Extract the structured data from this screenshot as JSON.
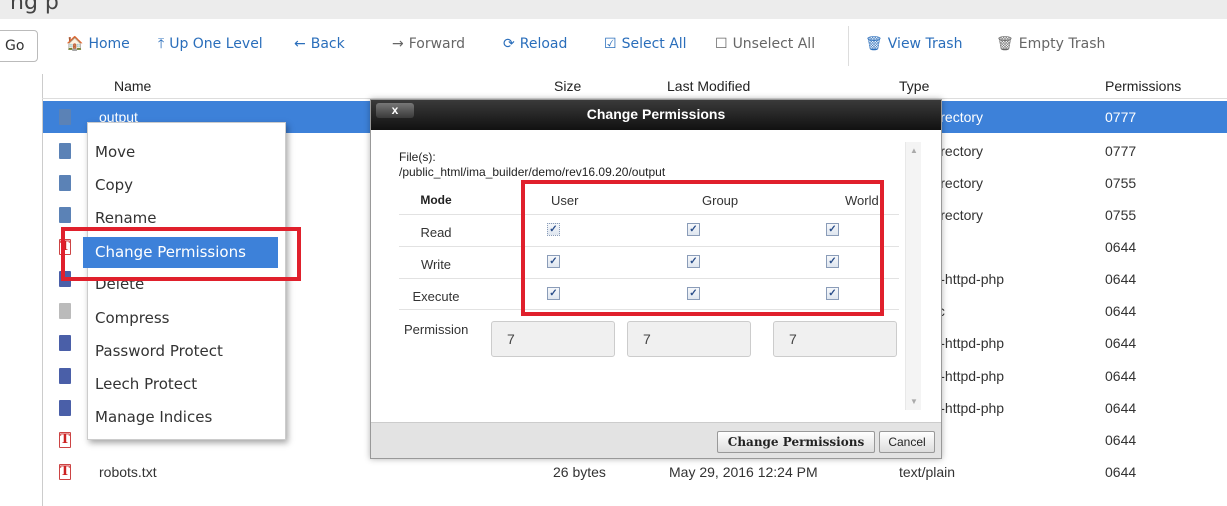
{
  "topstrip": {
    "text": "ng p"
  },
  "toolbar": {
    "go_label": "Go",
    "items": [
      {
        "label": "Home",
        "icon": "home-icon",
        "glyph": "🏠"
      },
      {
        "label": "Up One Level",
        "icon": "up-level-icon",
        "glyph": "⤒"
      },
      {
        "label": "Back",
        "icon": "back-arrow-icon",
        "glyph": "←"
      },
      {
        "label": "Forward",
        "icon": "forward-arrow-icon",
        "glyph": "→"
      },
      {
        "label": "Reload",
        "icon": "reload-icon",
        "glyph": "⟳"
      },
      {
        "label": "Select All",
        "icon": "checkbox-checked-icon",
        "glyph": "☑"
      },
      {
        "label": "Unselect All",
        "icon": "checkbox-empty-icon",
        "glyph": "☐"
      },
      {
        "label": "View Trash",
        "icon": "trash-icon",
        "glyph": "🗑"
      },
      {
        "label": "Empty Trash",
        "icon": "empty-trash-icon",
        "glyph": "🗑"
      }
    ]
  },
  "table": {
    "headers": [
      "Name",
      "Size",
      "Last Modified",
      "Type",
      "Permissions"
    ],
    "rows": [
      {
        "name": "output",
        "size": "",
        "modified": "",
        "type": "unix-directory",
        "perms": "0777",
        "icon": "folder-icon"
      },
      {
        "name": "",
        "size": "",
        "modified": "",
        "type": "unix-directory",
        "perms": "0777",
        "icon": "folder-icon"
      },
      {
        "name": "",
        "size": "",
        "modified": "",
        "type": "unix-directory",
        "perms": "0755",
        "icon": "folder-icon"
      },
      {
        "name": "",
        "size": "",
        "modified": "",
        "type": "unix-directory",
        "perms": "0755",
        "icon": "folder-icon"
      },
      {
        "name": "",
        "size": "",
        "modified": "",
        "type": "ain",
        "perms": "0644",
        "icon": "text-file-icon"
      },
      {
        "name": "",
        "size": "",
        "modified": "",
        "type": "ation/x-httpd-php",
        "perms": "0644",
        "icon": "php-file-icon"
      },
      {
        "name": "",
        "size": "",
        "modified": "",
        "type": "generic",
        "perms": "0644",
        "icon": "generic-file-icon"
      },
      {
        "name": "",
        "size": "",
        "modified": "",
        "type": "ation/x-httpd-php",
        "perms": "0644",
        "icon": "php-file-icon"
      },
      {
        "name": "",
        "size": "",
        "modified": "",
        "type": "ation/x-httpd-php",
        "perms": "0644",
        "icon": "php-file-icon"
      },
      {
        "name": "",
        "size": "",
        "modified": "",
        "type": "ation/x-httpd-php",
        "perms": "0644",
        "icon": "php-file-icon"
      },
      {
        "name": "",
        "size": "",
        "modified": "",
        "type": "ain",
        "perms": "0644",
        "icon": "text-file-icon"
      },
      {
        "name": "robots.txt",
        "size": "26 bytes",
        "modified": "May 29, 2016 12:24 PM",
        "type": "text/plain",
        "perms": "0644",
        "icon": "text-file-icon"
      }
    ]
  },
  "context_menu": {
    "items": [
      "Move",
      "Copy",
      "Rename",
      "Change Permissions",
      "Delete",
      "Compress",
      "Password Protect",
      "Leech Protect",
      "Manage Indices"
    ]
  },
  "dialog": {
    "title": "Change Permissions",
    "close_label": "x",
    "files_label": "File(s):",
    "files_path": "/public_html/ima_builder/demo/rev16.09.20/output",
    "mode_header": "Mode",
    "col_user": "User",
    "col_group": "Group",
    "col_world": "World",
    "row_read": "Read",
    "row_write": "Write",
    "row_execute": "Execute",
    "permission_label": "Permission",
    "values": {
      "user": "7",
      "group": "7",
      "world": "7"
    },
    "ok_label": "Change Permissions",
    "cancel_label": "Cancel"
  },
  "colors": {
    "accent": "#3d81d9",
    "highlight_red": "#e0202c",
    "link": "#2a6ebb"
  }
}
